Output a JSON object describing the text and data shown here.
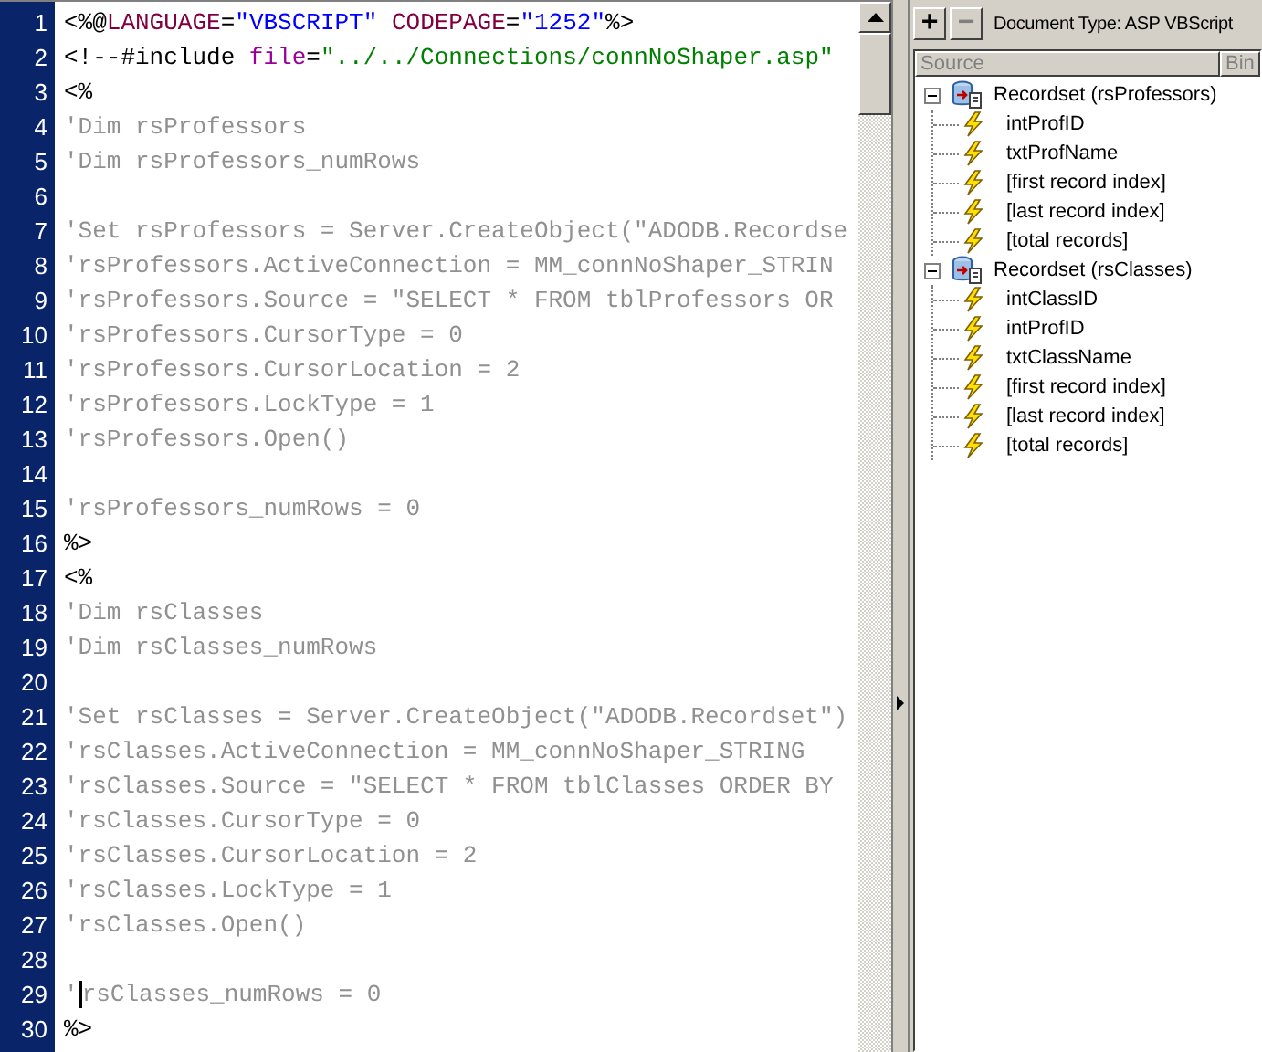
{
  "editor": {
    "lines": [
      {
        "number": "1",
        "tokens": [
          {
            "text": "<%@",
            "kind": "plain"
          },
          {
            "text": "LANGUAGE",
            "kind": "keyword"
          },
          {
            "text": "=",
            "kind": "plain"
          },
          {
            "text": "\"VBSCRIPT\" ",
            "kind": "string"
          },
          {
            "text": "CODEPAGE",
            "kind": "keyword"
          },
          {
            "text": "=",
            "kind": "plain"
          },
          {
            "text": "\"1252\"",
            "kind": "string"
          },
          {
            "text": "%>",
            "kind": "plain"
          }
        ]
      },
      {
        "number": "2",
        "tokens": [
          {
            "text": "<!--#include ",
            "kind": "plain"
          },
          {
            "text": "file",
            "kind": "attribute"
          },
          {
            "text": "=",
            "kind": "plain"
          },
          {
            "text": "\"../../Connections/connNoShaper.asp\"",
            "kind": "value"
          }
        ]
      },
      {
        "number": "3",
        "tokens": [
          {
            "text": "<%",
            "kind": "plain"
          }
        ]
      },
      {
        "number": "4",
        "tokens": [
          {
            "text": "'Dim rsProfessors",
            "kind": "comment"
          }
        ]
      },
      {
        "number": "5",
        "tokens": [
          {
            "text": "'Dim rsProfessors_numRows",
            "kind": "comment"
          }
        ]
      },
      {
        "number": "6"
      },
      {
        "number": "7",
        "tokens": [
          {
            "text": "'Set rsProfessors = Server.CreateObject(\"ADODB.Recordse",
            "kind": "comment"
          }
        ]
      },
      {
        "number": "8",
        "tokens": [
          {
            "text": "'rsProfessors.ActiveConnection = MM_connNoShaper_STRIN",
            "kind": "comment"
          }
        ]
      },
      {
        "number": "9",
        "tokens": [
          {
            "text": "'rsProfessors.Source = \"SELECT * FROM tblProfessors OR",
            "kind": "comment"
          }
        ]
      },
      {
        "number": "10",
        "tokens": [
          {
            "text": "'rsProfessors.CursorType = 0",
            "kind": "comment"
          }
        ]
      },
      {
        "number": "11",
        "tokens": [
          {
            "text": "'rsProfessors.CursorLocation = 2",
            "kind": "comment"
          }
        ]
      },
      {
        "number": "12",
        "tokens": [
          {
            "text": "'rsProfessors.LockType = 1",
            "kind": "comment"
          }
        ]
      },
      {
        "number": "13",
        "tokens": [
          {
            "text": "'rsProfessors.Open()",
            "kind": "comment"
          }
        ]
      },
      {
        "number": "14"
      },
      {
        "number": "15",
        "tokens": [
          {
            "text": "'rsProfessors_numRows = 0",
            "kind": "comment"
          }
        ]
      },
      {
        "number": "16",
        "tokens": [
          {
            "text": "%>",
            "kind": "plain"
          }
        ]
      },
      {
        "number": "17",
        "tokens": [
          {
            "text": "<%",
            "kind": "plain"
          }
        ]
      },
      {
        "number": "18",
        "tokens": [
          {
            "text": "'Dim rsClasses",
            "kind": "comment"
          }
        ]
      },
      {
        "number": "19",
        "tokens": [
          {
            "text": "'Dim rsClasses_numRows",
            "kind": "comment"
          }
        ]
      },
      {
        "number": "20"
      },
      {
        "number": "21",
        "tokens": [
          {
            "text": "'Set rsClasses = Server.CreateObject(\"ADODB.Recordset\")",
            "kind": "comment"
          }
        ]
      },
      {
        "number": "22",
        "tokens": [
          {
            "text": "'rsClasses.ActiveConnection = MM_connNoShaper_STRING",
            "kind": "comment"
          }
        ]
      },
      {
        "number": "23",
        "tokens": [
          {
            "text": "'rsClasses.Source = \"SELECT * FROM tblClasses ORDER BY",
            "kind": "comment"
          }
        ]
      },
      {
        "number": "24",
        "tokens": [
          {
            "text": "'rsClasses.CursorType = 0",
            "kind": "comment"
          }
        ]
      },
      {
        "number": "25",
        "tokens": [
          {
            "text": "'rsClasses.CursorLocation = 2",
            "kind": "comment"
          }
        ]
      },
      {
        "number": "26",
        "tokens": [
          {
            "text": "'rsClasses.LockType = 1",
            "kind": "comment"
          }
        ]
      },
      {
        "number": "27",
        "tokens": [
          {
            "text": "'rsClasses.Open()",
            "kind": "comment"
          }
        ]
      },
      {
        "number": "28"
      },
      {
        "number": "29",
        "tokens": [
          {
            "text": "'",
            "kind": "comment"
          },
          {
            "kind": "caret"
          },
          {
            "text": "rsClasses_numRows = 0",
            "kind": "comment"
          }
        ]
      },
      {
        "number": "30",
        "tokens": [
          {
            "text": "%>",
            "kind": "plain"
          }
        ]
      }
    ]
  },
  "bindings_panel": {
    "toolbar": {
      "add_button": "+",
      "remove_button": "−",
      "document_type": "Document Type: ASP VBScript"
    },
    "columns": [
      "Source",
      "Bin"
    ],
    "tree": [
      {
        "label": "Recordset (rsProfessors)",
        "expanded": true,
        "children": [
          {
            "label": "intProfID"
          },
          {
            "label": "txtProfName"
          },
          {
            "label": "[first record index]"
          },
          {
            "label": "[last record index]"
          },
          {
            "label": "[total records]"
          }
        ]
      },
      {
        "label": "Recordset (rsClasses)",
        "expanded": true,
        "children": [
          {
            "label": "intClassID"
          },
          {
            "label": "intProfID"
          },
          {
            "label": "txtClassName"
          },
          {
            "label": "[first record index]"
          },
          {
            "label": "[last record index]"
          },
          {
            "label": "[total records]"
          }
        ]
      }
    ]
  }
}
